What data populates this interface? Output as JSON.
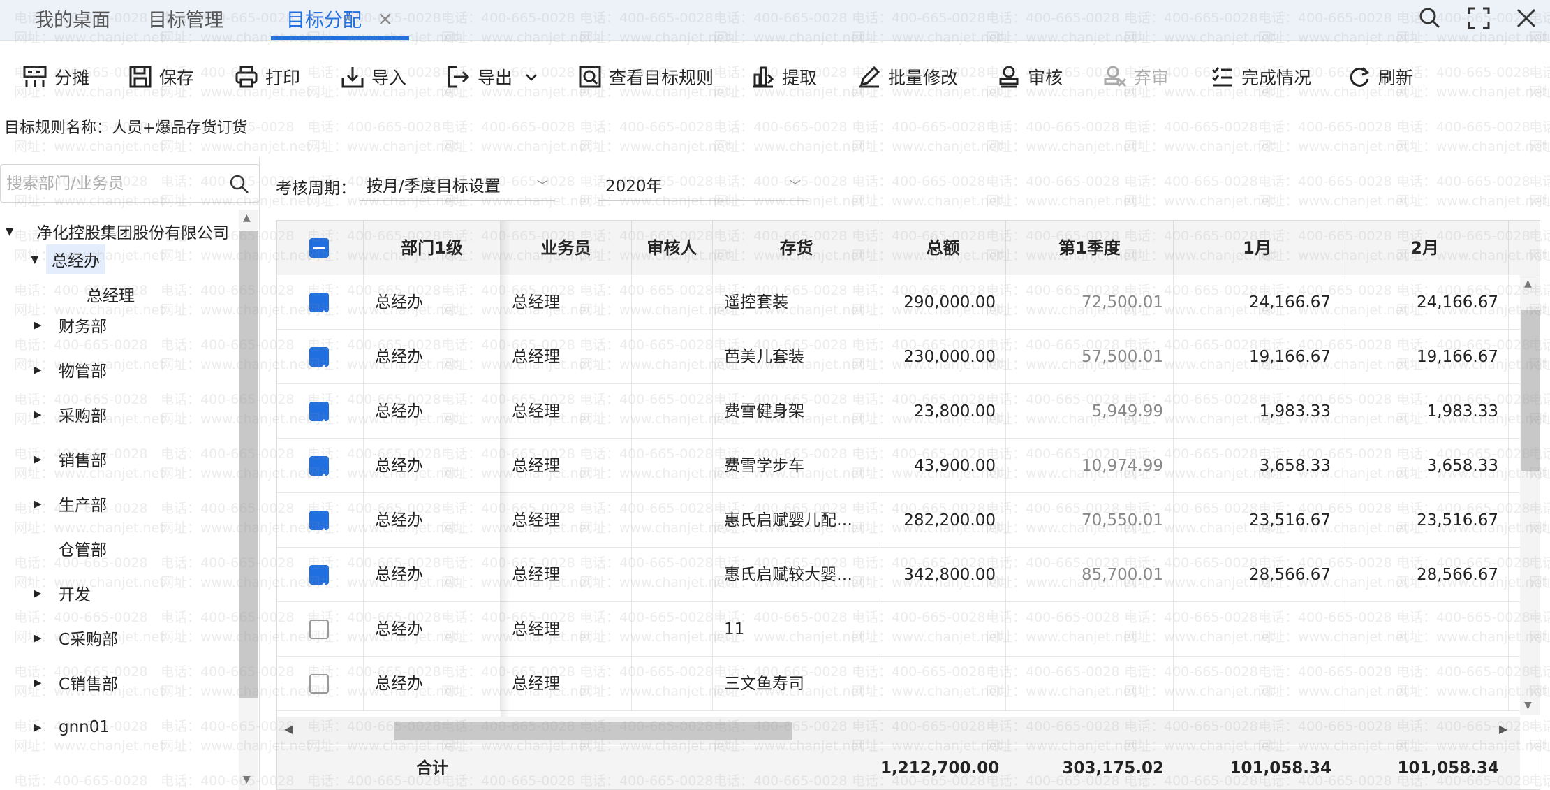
{
  "tabs": {
    "desktop": "我的桌面",
    "target_mgmt": "目标管理",
    "target_alloc": "目标分配",
    "close": "×"
  },
  "toolbar": {
    "split": "分摊",
    "save": "保存",
    "print": "打印",
    "import": "导入",
    "export": "导出",
    "view_rule": "查看目标规则",
    "extract": "提取",
    "batch_edit": "批量修改",
    "audit": "审核",
    "abandon": "弃审",
    "completion": "完成情况",
    "refresh": "刷新"
  },
  "rule": {
    "label": "目标规则名称：",
    "value": "人员+爆品存货订货"
  },
  "left": {
    "search_placeholder": "搜索部门/业务员",
    "tree": [
      "净化控股集团股份有限公司",
      "总经办",
      "总经理",
      "财务部",
      "物管部",
      "采购部",
      "销售部",
      "生产部",
      "仓管部",
      "开发",
      "C采购部",
      "C销售部",
      "gnn01"
    ]
  },
  "filter": {
    "period_label": "考核周期：",
    "period_value": "按月/季度目标设置",
    "year_value": "2020年"
  },
  "grid": {
    "headers": {
      "dept": "部门1级",
      "salesman": "业务员",
      "auditor": "审核人",
      "stock": "存货",
      "total": "总额",
      "q1": "第1季度",
      "m1": "1月",
      "m2": "2月"
    },
    "rows": [
      {
        "dept": "总经办",
        "salesman": "总经理",
        "auditor": "",
        "stock": "遥控套装",
        "total": "290,000.00",
        "q1": "72,500.01",
        "m1": "24,166.67",
        "m2": "24,166.67",
        "checked": true
      },
      {
        "dept": "总经办",
        "salesman": "总经理",
        "auditor": "",
        "stock": "芭美儿套装",
        "total": "230,000.00",
        "q1": "57,500.01",
        "m1": "19,166.67",
        "m2": "19,166.67",
        "checked": true
      },
      {
        "dept": "总经办",
        "salesman": "总经理",
        "auditor": "",
        "stock": "费雪健身架",
        "total": "23,800.00",
        "q1": "5,949.99",
        "m1": "1,983.33",
        "m2": "1,983.33",
        "checked": true
      },
      {
        "dept": "总经办",
        "salesman": "总经理",
        "auditor": "",
        "stock": "费雪学步车",
        "total": "43,900.00",
        "q1": "10,974.99",
        "m1": "3,658.33",
        "m2": "3,658.33",
        "checked": true
      },
      {
        "dept": "总经办",
        "salesman": "总经理",
        "auditor": "",
        "stock": "惠氏启赋婴儿配…",
        "total": "282,200.00",
        "q1": "70,550.01",
        "m1": "23,516.67",
        "m2": "23,516.67",
        "checked": true
      },
      {
        "dept": "总经办",
        "salesman": "总经理",
        "auditor": "",
        "stock": "惠氏启赋较大婴…",
        "total": "342,800.00",
        "q1": "85,700.01",
        "m1": "28,566.67",
        "m2": "28,566.67",
        "checked": true
      },
      {
        "dept": "总经办",
        "salesman": "总经理",
        "auditor": "",
        "stock": "11",
        "total": "",
        "q1": "",
        "m1": "",
        "m2": "",
        "checked": false
      },
      {
        "dept": "总经办",
        "salesman": "总经理",
        "auditor": "",
        "stock": "三文鱼寿司",
        "total": "",
        "q1": "",
        "m1": "",
        "m2": "",
        "checked": false
      }
    ],
    "totals": {
      "label": "合计",
      "total": "1,212,700.00",
      "q1": "303,175.02",
      "m1": "101,058.34",
      "m2": "101,058.34"
    }
  },
  "watermark": {
    "phone": "电话：400-665-0028",
    "site": "网址：www.chanjet.net"
  },
  "colors": {
    "accent": "#1f6fe0",
    "header_bg": "#f4f4f4",
    "tabbar_bg": "#edf1f8"
  }
}
